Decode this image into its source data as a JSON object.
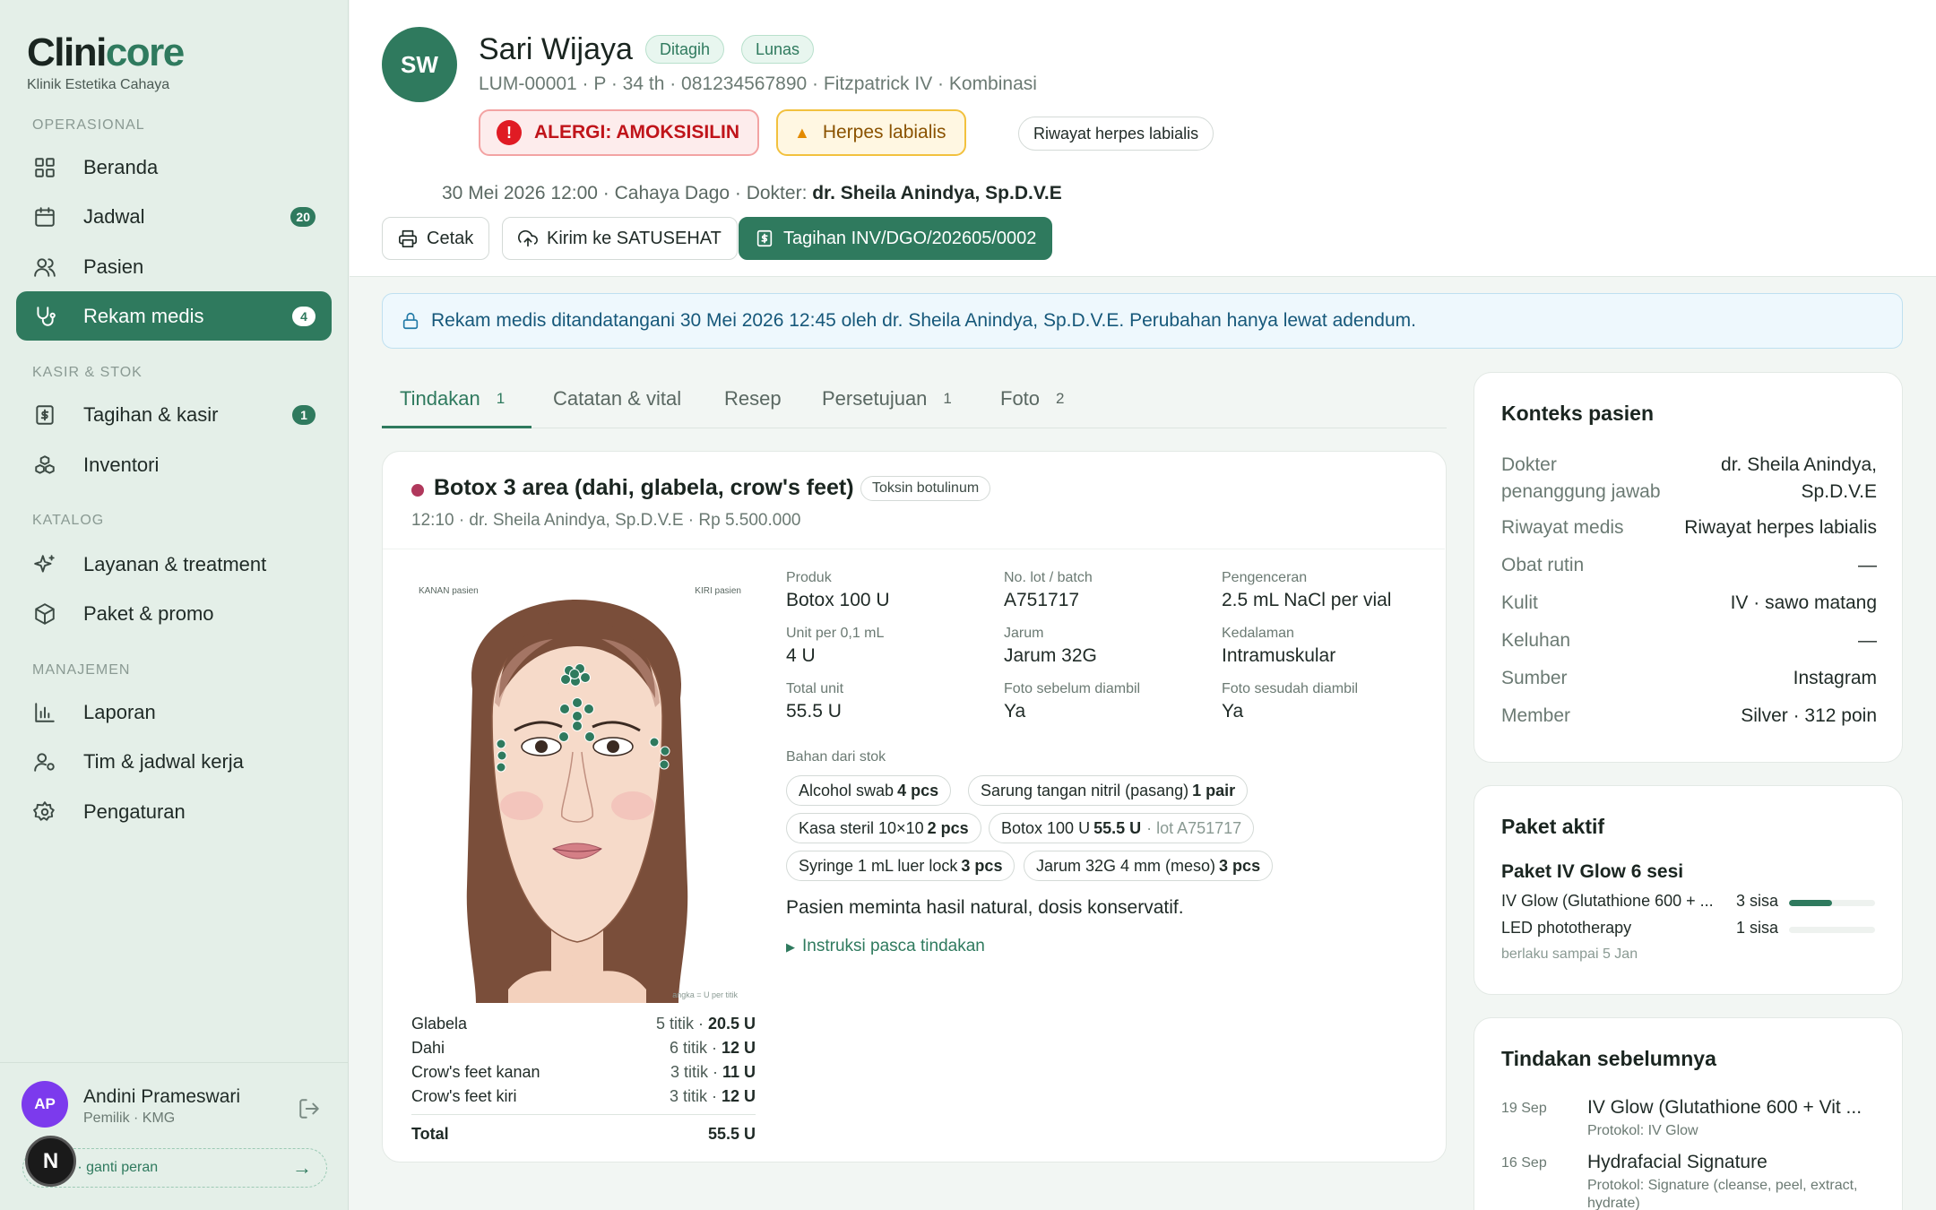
{
  "sidebar": {
    "brand_main": "Clini",
    "brand_accent": "core",
    "brand_sub": "Klinik Estetika Cahaya",
    "sections": [
      {
        "label": "OPERASIONAL"
      },
      {
        "label": "KASIR & STOK"
      },
      {
        "label": "KATALOG"
      },
      {
        "label": "MANAJEMEN"
      }
    ],
    "items": [
      {
        "label": "Beranda",
        "icon": "grid-icon"
      },
      {
        "label": "Jadwal",
        "icon": "calendar-icon",
        "badge": "20"
      },
      {
        "label": "Pasien",
        "icon": "users-icon"
      },
      {
        "label": "Rekam medis",
        "icon": "stethoscope-icon",
        "badge": "4",
        "active": true
      },
      {
        "label": "Tagihan & kasir",
        "icon": "receipt-icon",
        "badge": "1"
      },
      {
        "label": "Inventori",
        "icon": "boxes-icon"
      },
      {
        "label": "Layanan & treatment",
        "icon": "sparkles-icon"
      },
      {
        "label": "Paket & promo",
        "icon": "package-icon"
      },
      {
        "label": "Laporan",
        "icon": "bar-chart-icon"
      },
      {
        "label": "Tim & jadwal kerja",
        "icon": "user-cog-icon"
      },
      {
        "label": "Pengaturan",
        "icon": "gear-icon"
      }
    ],
    "user": {
      "initials": "AP",
      "name": "Andini Prameswari",
      "role": "Pemilik · KMG"
    },
    "demo_label": "o · ganti peran",
    "n_badge": "N"
  },
  "patient": {
    "initials": "SW",
    "name": "Sari Wijaya",
    "status_billing": "Ditagih",
    "status_paid": "Lunas",
    "meta": "LUM-00001 · P · 34 th · 081234567890 · Fitzpatrick IV · Kombinasi",
    "allergy": "ALERGI: AMOKSISILIN",
    "warning": "Herpes labialis",
    "history_pill": "Riwayat herpes labialis",
    "visit_meta_prefix": "30 Mei 2026 12:00 · Cahaya Dago · Dokter: ",
    "visit_doctor": "dr. Sheila Anindya, Sp.D.V.E"
  },
  "actions": {
    "print": "Cetak",
    "satusehat": "Kirim ke SATUSEHAT",
    "invoice": "Tagihan INV/DGO/202605/0002"
  },
  "banner": "Rekam medis ditandatangani 30 Mei 2026 12:45 oleh dr. Sheila Anindya, Sp.D.V.E. Perubahan hanya lewat adendum.",
  "tabs": [
    {
      "label": "Tindakan",
      "count": "1"
    },
    {
      "label": "Catatan & vital",
      "count": ""
    },
    {
      "label": "Resep",
      "count": ""
    },
    {
      "label": "Persetujuan",
      "count": "1"
    },
    {
      "label": "Foto",
      "count": "2"
    }
  ],
  "procedure": {
    "title": "Botox 3 area (dahi, glabela, crow's feet)",
    "tag": "Toksin botulinum",
    "sub": "12:10 · dr. Sheila Anindya, Sp.D.V.E · Rp 5.500.000",
    "face_label_right": "KANAN pasien",
    "face_label_left": "KIRI pasien",
    "face_legend": "angka = U per titik",
    "areas": [
      {
        "name": "Glabela",
        "points": "5 titik · ",
        "units": "20.5 U"
      },
      {
        "name": "Dahi",
        "points": "6 titik · ",
        "units": "12 U"
      },
      {
        "name": "Crow's feet kanan",
        "points": "3 titik · ",
        "units": "11 U"
      },
      {
        "name": "Crow's feet kiri",
        "points": "3 titik · ",
        "units": "12 U"
      }
    ],
    "total_label": "Total",
    "total_value": "55.5 U",
    "fields": [
      {
        "k": "Produk",
        "v": "Botox 100 U"
      },
      {
        "k": "No. lot / batch",
        "v": "A751717"
      },
      {
        "k": "Pengenceran",
        "v": "2.5 mL NaCl per vial"
      },
      {
        "k": "Unit per 0,1 mL",
        "v": "4 U"
      },
      {
        "k": "Jarum",
        "v": "Jarum 32G"
      },
      {
        "k": "Kedalaman",
        "v": "Intramuskular"
      },
      {
        "k": "Total unit",
        "v": "55.5 U"
      },
      {
        "k": "Foto sebelum diambil",
        "v": "Ya"
      },
      {
        "k": "Foto sesudah diambil",
        "v": "Ya"
      }
    ],
    "stock_label": "Bahan dari stok",
    "stock": [
      {
        "name": "Alcohol swab",
        "qty": "4 pcs",
        "lot": ""
      },
      {
        "name": "Sarung tangan nitril (pasang)",
        "qty": "1 pair",
        "lot": ""
      },
      {
        "name": "Kasa steril 10×10",
        "qty": "2 pcs",
        "lot": ""
      },
      {
        "name": "Botox 100 U",
        "qty": "55.5 U",
        "lot": "· lot A751717"
      },
      {
        "name": "Syringe 1 mL luer lock",
        "qty": "3 pcs",
        "lot": ""
      },
      {
        "name": "Jarum 32G 4 mm (meso)",
        "qty": "3 pcs",
        "lot": ""
      }
    ],
    "note": "Pasien meminta hasil natural, dosis konservatif.",
    "instructions": "Instruksi pasca tindakan"
  },
  "context": {
    "title": "Konteks pasien",
    "rows": [
      {
        "k1": "Dokter",
        "k2": "penanggung jawab",
        "v1": "dr. Sheila Anindya,",
        "v2": "Sp.D.V.E"
      },
      {
        "k1": "Riwayat medis",
        "v1": "Riwayat herpes labialis"
      },
      {
        "k1": "Obat rutin",
        "v1": "—"
      },
      {
        "k1": "Kulit",
        "v1": "IV · sawo matang"
      },
      {
        "k1": "Keluhan",
        "v1": "—"
      },
      {
        "k1": "Sumber",
        "v1": "Instagram"
      },
      {
        "k1": "Member",
        "v1": "Silver · 312 poin"
      }
    ]
  },
  "package": {
    "title": "Paket aktif",
    "name": "Paket IV Glow 6 sesi",
    "items": [
      {
        "name": "IV Glow (Glutathione 600 + ...",
        "remaining": "3 sisa",
        "fraction": 0.5
      },
      {
        "name": "LED phototherapy",
        "remaining": "1 sisa",
        "fraction": 0
      }
    ],
    "valid": "berlaku sampai 5 Jan"
  },
  "previous": {
    "title": "Tindakan sebelumnya",
    "items": [
      {
        "date": "19 Sep",
        "title": "IV Glow (Glutathione 600 + Vit ...",
        "protocol": "Protokol: IV Glow"
      },
      {
        "date": "16 Sep",
        "title": "Hydrafacial Signature",
        "protocol": "Protokol: Signature (cleanse, peel, extract, hydrate)"
      }
    ]
  },
  "colors": {
    "primary": "#2f7a5e",
    "sidebar_bg": "#e4efe8",
    "danger": "#e01b24",
    "warning": "#f2c13e",
    "info": "#2079a6"
  }
}
